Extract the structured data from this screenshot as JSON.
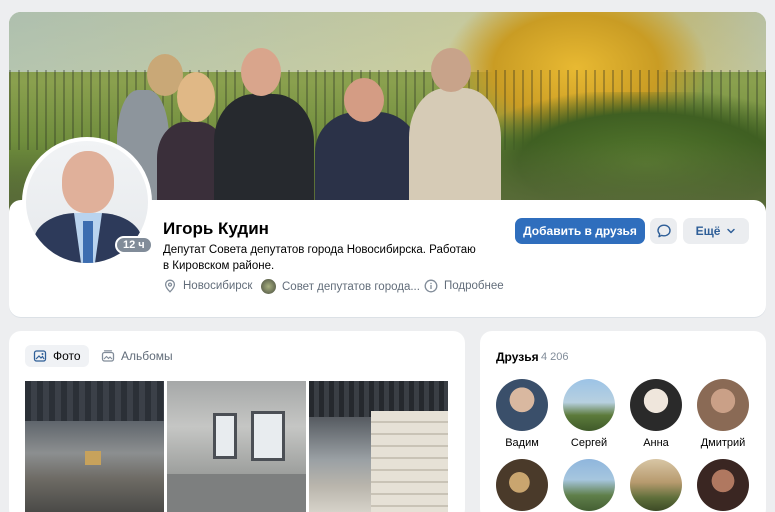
{
  "profile": {
    "name": "Игорь Кудин",
    "status": "Депутат Совета депутатов города Новосибирска. Работаю в Кировском районе.",
    "online_badge": "12 ч",
    "city": "Новосибирск",
    "organization": "Совет депутатов города...",
    "more_info": "Подробнее"
  },
  "actions": {
    "add_friend": "Добавить в друзья",
    "more": "Ещё"
  },
  "photos": {
    "tabs": [
      {
        "label": "Фото",
        "active": true
      },
      {
        "label": "Альбомы",
        "active": false
      }
    ]
  },
  "friends": {
    "title": "Друзья",
    "count": "4 206",
    "items": [
      {
        "name": "Вадим"
      },
      {
        "name": "Сергей"
      },
      {
        "name": "Анна"
      },
      {
        "name": "Дмитрий"
      },
      {
        "name": ""
      },
      {
        "name": ""
      },
      {
        "name": ""
      },
      {
        "name": ""
      }
    ]
  },
  "colors": {
    "accent": "#2f6ebd",
    "background": "#edeef0",
    "secondary_text": "#626d7a"
  }
}
